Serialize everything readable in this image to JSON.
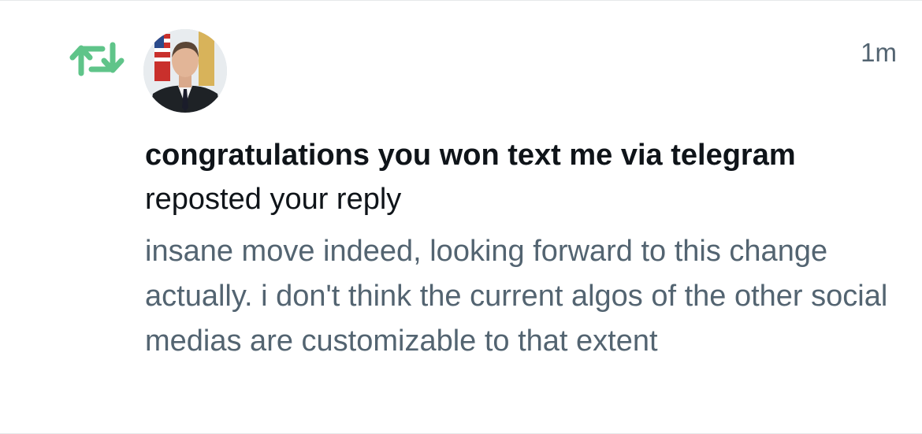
{
  "notification": {
    "type_icon": "repost-icon",
    "accent_color": "#00ba7c",
    "timestamp": "1m",
    "user_name": "congratulations you won text me via telegram",
    "action_text": "reposted your reply",
    "reply_text": "insane move indeed, looking forward to this change actually. i don't think the current algos of the other social medias are customizable to that extent"
  }
}
